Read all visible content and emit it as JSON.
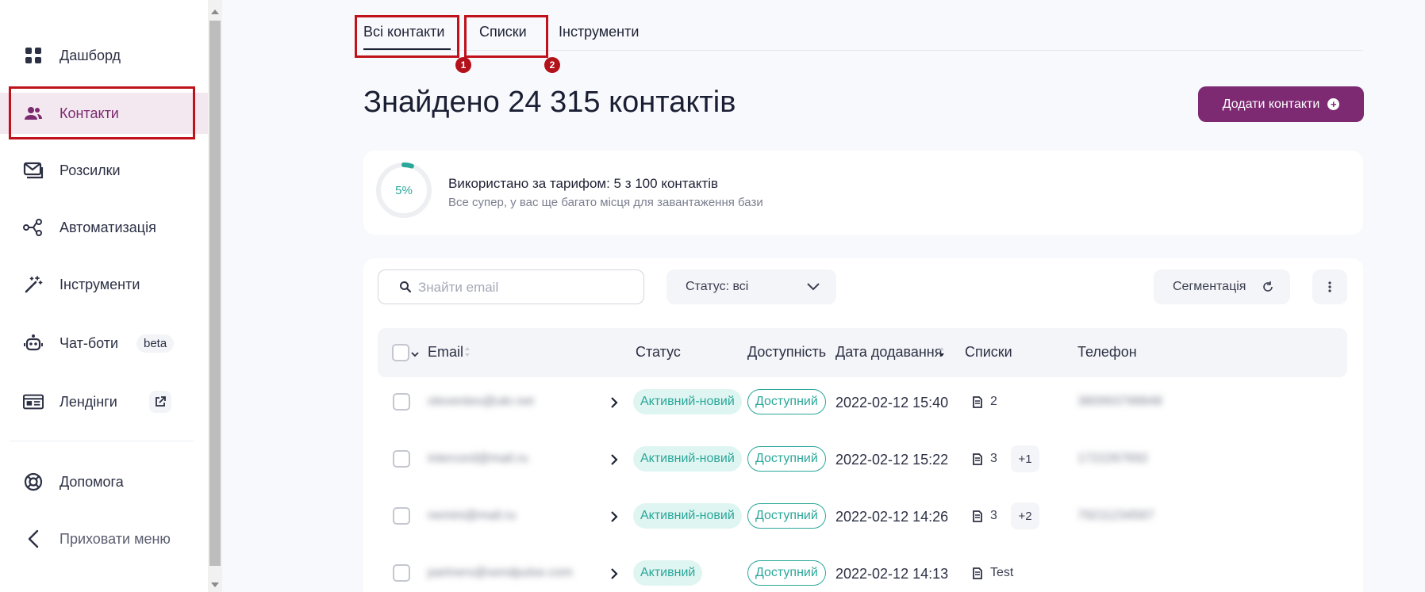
{
  "sidebar": {
    "items": [
      {
        "label": "Дашборд",
        "icon": "dashboard-icon"
      },
      {
        "label": "Контакти",
        "icon": "users-icon"
      },
      {
        "label": "Розсилки",
        "icon": "mail-icon"
      },
      {
        "label": "Автоматизація",
        "icon": "automation-icon"
      },
      {
        "label": "Інструменти",
        "icon": "magic-wand-icon"
      },
      {
        "label": "Чат-боти",
        "icon": "bot-icon",
        "tag": "beta"
      },
      {
        "label": "Лендінги",
        "icon": "landing-icon"
      }
    ],
    "bottom": [
      {
        "label": "Допомога",
        "icon": "help-icon"
      },
      {
        "label": "Приховати меню",
        "icon": "chevron-left-icon"
      }
    ]
  },
  "tabs": [
    {
      "label": "Всі контакти",
      "badge": "1"
    },
    {
      "label": "Списки",
      "badge": "2"
    },
    {
      "label": "Інструменти"
    }
  ],
  "page": {
    "title": "Знайдено 24 315 контактів",
    "add_button": "Додати контакти"
  },
  "usage": {
    "percent_label": "5%",
    "percent": 5,
    "title": "Використано за тарифом: 5 з 100 контактів",
    "subtitle": "Все супер, у вас ще багато місця для завантаження бази"
  },
  "toolbar": {
    "search_placeholder": "Знайти email",
    "status_filter": "Статус: всі",
    "segmentation": "Сегментація"
  },
  "table": {
    "headers": [
      "Email",
      "Статус",
      "Доступність",
      "Дата додавання",
      "Списки",
      "Телефон"
    ],
    "rows": [
      {
        "email": "oleventeo@ukr.net",
        "status": "Активний-новий",
        "availability": "Доступний",
        "date": "2022-02-12 15:40",
        "lists": "2",
        "extra": "",
        "phone": "380993798848"
      },
      {
        "email": "intercord@mail.ru",
        "status": "Активний-новий",
        "availability": "Доступний",
        "date": "2022-02-12 15:22",
        "lists": "3",
        "extra": "+1",
        "phone": "1722267692"
      },
      {
        "email": "nemini@mail.ru",
        "status": "Активний-новий",
        "availability": "Доступний",
        "date": "2022-02-12 14:26",
        "lists": "3",
        "extra": "+2",
        "phone": "79211234567"
      },
      {
        "email": "partners@sendpulse.com",
        "status": "Активний",
        "availability": "Доступний",
        "date": "2022-02-12 14:13",
        "lists": "Test",
        "extra": "",
        "phone": ""
      }
    ]
  },
  "colors": {
    "accent": "#7d2a72",
    "teal": "#2aa79a",
    "annotation_red": "#c0121b"
  }
}
